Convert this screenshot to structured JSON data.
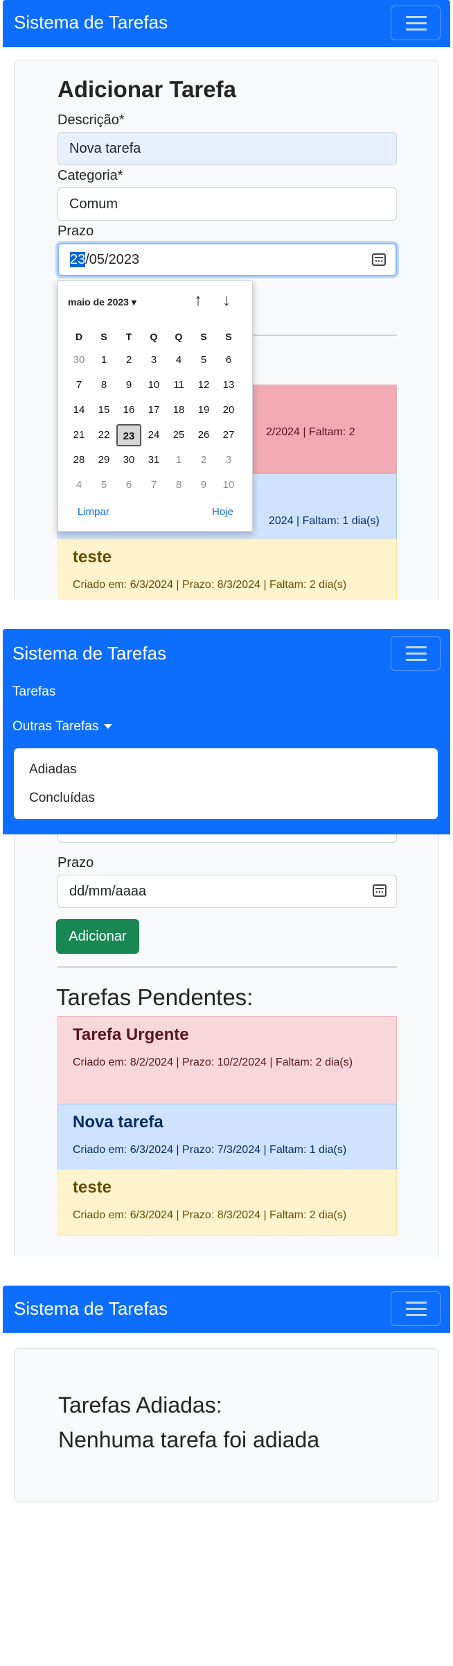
{
  "app": {
    "brand": "Sistema de Tarefas"
  },
  "form": {
    "title": "Adicionar Tarefa",
    "descricao_label": "Descrição*",
    "descricao_value": "Nova tarefa",
    "categoria_label": "Categoria*",
    "categoria_value": "Comum",
    "prazo_label": "Prazo",
    "prazo_value_day": "23",
    "prazo_value_rest": "/05/2023",
    "prazo_placeholder": "dd/mm/aaaa",
    "add_button": "Adicionar"
  },
  "datepicker": {
    "month_label": "maio de 2023 ▾",
    "up_arrow": "↑",
    "down_arrow": "↓",
    "weekdays": [
      "D",
      "S",
      "T",
      "Q",
      "Q",
      "S",
      "S"
    ],
    "weeks": [
      [
        {
          "d": "30",
          "m": true
        },
        {
          "d": "1"
        },
        {
          "d": "2"
        },
        {
          "d": "3"
        },
        {
          "d": "4"
        },
        {
          "d": "5"
        },
        {
          "d": "6"
        }
      ],
      [
        {
          "d": "7"
        },
        {
          "d": "8"
        },
        {
          "d": "9"
        },
        {
          "d": "10"
        },
        {
          "d": "11"
        },
        {
          "d": "12"
        },
        {
          "d": "13"
        }
      ],
      [
        {
          "d": "14"
        },
        {
          "d": "15"
        },
        {
          "d": "16"
        },
        {
          "d": "17"
        },
        {
          "d": "18"
        },
        {
          "d": "19"
        },
        {
          "d": "20"
        }
      ],
      [
        {
          "d": "21"
        },
        {
          "d": "22"
        },
        {
          "d": "23",
          "t": true
        },
        {
          "d": "24"
        },
        {
          "d": "25"
        },
        {
          "d": "26"
        },
        {
          "d": "27"
        }
      ],
      [
        {
          "d": "28"
        },
        {
          "d": "29"
        },
        {
          "d": "30"
        },
        {
          "d": "31"
        },
        {
          "d": "1",
          "m": true
        },
        {
          "d": "2",
          "m": true
        },
        {
          "d": "3",
          "m": true
        }
      ],
      [
        {
          "d": "4",
          "m": true
        },
        {
          "d": "5",
          "m": true
        },
        {
          "d": "6",
          "m": true
        },
        {
          "d": "7",
          "m": true
        },
        {
          "d": "8",
          "m": true
        },
        {
          "d": "9",
          "m": true
        },
        {
          "d": "10",
          "m": true
        }
      ]
    ],
    "clear_label": "Limpar",
    "today_label": "Hoje"
  },
  "pending": {
    "title": "Tarefas Pendentes:",
    "tasks": [
      {
        "title": "Tarefa Urgente",
        "meta": "Criado em: 8/2/2024 | Prazo: 10/2/2024 | Faltam: 2 dia(s)",
        "meta_visible_1": "2/2024 | Faltam: 2"
      },
      {
        "title": "Nova tarefa",
        "meta": "Criado em: 6/3/2024 | Prazo: 7/3/2024 | Faltam: 1 dia(s)",
        "meta_visible_1": "2024 | Faltam: 1 dia(s)"
      },
      {
        "title": "teste",
        "meta": "Criado em: 6/3/2024 | Prazo: 8/3/2024 | Faltam: 2 dia(s)"
      }
    ]
  },
  "nav": {
    "link_tarefas": "Tarefas",
    "dropdown_label": "Outras Tarefas",
    "dropdown_items": [
      "Adiadas",
      "Concluídas"
    ]
  },
  "adiadas": {
    "title": "Tarefas Adiadas:",
    "empty_message": "Nenhuma tarefa foi adiada"
  },
  "colors": {
    "primary": "#0d6efd",
    "success": "#198754",
    "danger_bg": "#f8d7da",
    "primary_bg": "#cfe2ff",
    "warning_bg": "#fff3cd"
  }
}
